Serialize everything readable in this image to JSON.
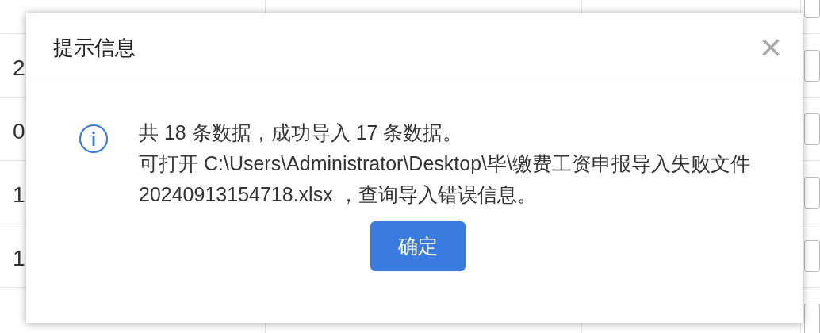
{
  "table": {
    "rows": [
      {
        "cells": [
          "",
          "",
          ""
        ]
      },
      {
        "cells": [
          "2",
          "",
          ""
        ]
      },
      {
        "cells": [
          "0",
          "",
          ""
        ]
      },
      {
        "cells": [
          "1",
          "",
          ""
        ]
      },
      {
        "cells": [
          "1",
          "",
          ""
        ]
      },
      {
        "cells": [
          "",
          "",
          ""
        ]
      }
    ]
  },
  "dialog": {
    "title": "提示信息",
    "close": "×",
    "message": [
      "共 18 条数据，成功导入 17 条数据。",
      "可打开 C:\\Users\\Administrator\\Desktop\\毕\\缴费工资申报导入失败文件20240913154718.xlsx ，查询导入错误信息。"
    ],
    "button": "确定"
  }
}
